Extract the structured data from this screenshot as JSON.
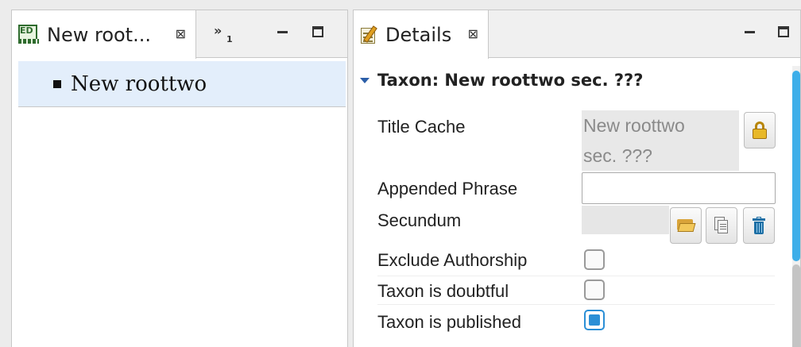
{
  "navigator": {
    "tab_title": "New root...",
    "tab_close": "⊠",
    "overflow_chevron": "»",
    "overflow_count": "1",
    "tree_items": [
      "New roottwo"
    ]
  },
  "details": {
    "tab_title": "Details",
    "tab_close": "⊠",
    "section_title": "Taxon: New roottwo sec. ???",
    "title_cache": {
      "label": "Title Cache",
      "value_line1": "New roottwo",
      "value_line2": "sec. ???"
    },
    "appended_phrase": {
      "label": "Appended Phrase",
      "value": ""
    },
    "secundum": {
      "label": "Secundum",
      "value": ""
    },
    "exclude_authorship": {
      "label": "Exclude Authorship",
      "checked": false
    },
    "taxon_doubtful": {
      "label": "Taxon is doubtful",
      "checked": false
    },
    "taxon_published": {
      "label": "Taxon is published",
      "checked": true
    }
  },
  "icons": [
    "editor-icon",
    "details-icon",
    "lock-icon",
    "folder-open-icon",
    "copy-icon",
    "trash-icon",
    "minimize-icon",
    "maximize-icon",
    "close-icon"
  ],
  "colors": {
    "accent": "#2b8fd6",
    "selection": "#e3eefb",
    "scroll_thumb": "#3daee9"
  }
}
